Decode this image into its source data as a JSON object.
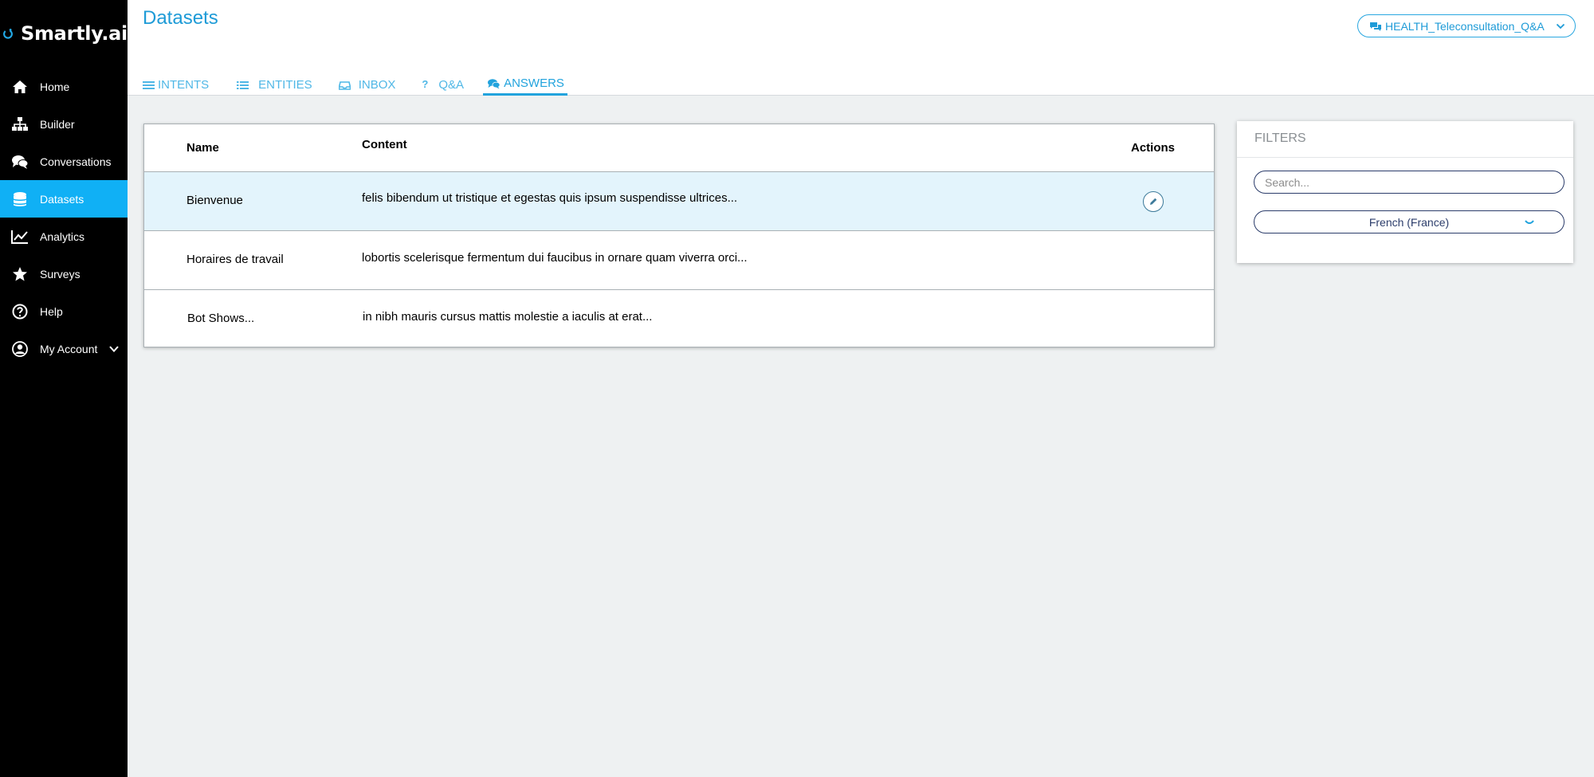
{
  "app": {
    "brand": "Smartly.ai",
    "accent": "#10b0f5",
    "sidebar_bg": "#000000"
  },
  "sidebar": {
    "items": [
      {
        "label": "Home",
        "icon": "home-icon"
      },
      {
        "label": "Builder",
        "icon": "sitemap-icon"
      },
      {
        "label": "Conversations",
        "icon": "chat-bubbles-icon"
      },
      {
        "label": "Datasets",
        "icon": "database-icon",
        "active": true
      },
      {
        "label": "Analytics",
        "icon": "line-chart-icon"
      },
      {
        "label": "Surveys",
        "icon": "star-icon"
      },
      {
        "label": "Help",
        "icon": "question-circle-icon"
      },
      {
        "label": "My Account",
        "icon": "user-circle-icon",
        "caret": "chevron-down-icon"
      }
    ]
  },
  "header": {
    "title": "Datasets",
    "project_selector": "HEALTH_Teleconsultation_Q&A"
  },
  "tabs": [
    {
      "label": "INTENTS",
      "icon": "list-icon"
    },
    {
      "label": "ENTITIES",
      "icon": "bulleted-list-icon"
    },
    {
      "label": "INBOX",
      "icon": "inbox-icon"
    },
    {
      "label": "Q&A",
      "icon": "question-icon"
    },
    {
      "label": "ANSWERS",
      "icon": "comments-icon",
      "active": true
    }
  ],
  "table": {
    "columns": [
      "Name",
      "Content",
      "Actions"
    ],
    "rows": [
      {
        "name": "Bienvenue",
        "content": "felis bibendum ut tristique et egestas quis ipsum suspendisse ultrices...",
        "selected": true,
        "action_icon": "pencil-icon"
      },
      {
        "name": "Horaires de travail",
        "content": "lobortis scelerisque fermentum dui faucibus in ornare quam viverra orci..."
      },
      {
        "name": "Bot Shows...",
        "content": "in nibh mauris cursus mattis molestie a iaculis at erat..."
      }
    ]
  },
  "filters": {
    "title": "FILTERS",
    "search_placeholder": "Search...",
    "language": "French (France)"
  }
}
